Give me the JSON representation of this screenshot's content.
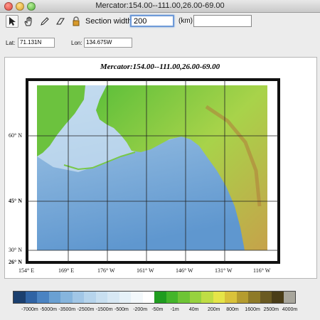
{
  "window": {
    "title": "Mercator:154.00--111.00,26.00-69.00"
  },
  "toolbar": {
    "icons": [
      "pointer-arrow-icon",
      "hand-pan-icon",
      "pencil-icon",
      "eraser-icon",
      "lock-icon"
    ],
    "section_label": "Section width:",
    "section_value": "200",
    "unit_label": "(km)"
  },
  "coords": {
    "lat_label": "Lat:",
    "lat_value": "71.131N",
    "lon_label": "Lon:",
    "lon_value": "134.675W"
  },
  "map": {
    "title": "Mercator:154.00--111.00,26.00-69.00",
    "lat_labels": [
      "60° N",
      "45° N",
      "30° N",
      "26° N"
    ],
    "lon_labels": [
      "154° E",
      "169° E",
      "176° W",
      "161° W",
      "146° W",
      "131° W",
      "116° W"
    ]
  },
  "colorbar": {
    "colors": [
      "#1b3f6e",
      "#2f63a4",
      "#4a83c2",
      "#6aa0d2",
      "#86b5dd",
      "#a1c6e6",
      "#b6d4ec",
      "#c8dff0",
      "#d7e8f4",
      "#e6f1f8",
      "#f3f8fb",
      "#ffffff",
      "#1f9c1f",
      "#43b52a",
      "#6dc435",
      "#97d23f",
      "#bfdd44",
      "#e5e548",
      "#d9c23a",
      "#b59c2f",
      "#8e7a28",
      "#6a5a22",
      "#4a3d18",
      "#a8a69c"
    ],
    "labels": [
      "-7000m",
      "-5000m",
      "-3500m",
      "-2500m",
      "-1500m",
      "-500m",
      "-200m",
      "-50m",
      "-1m",
      "40m",
      "200m",
      "800m",
      "1600m",
      "2500m",
      "4000m"
    ]
  }
}
